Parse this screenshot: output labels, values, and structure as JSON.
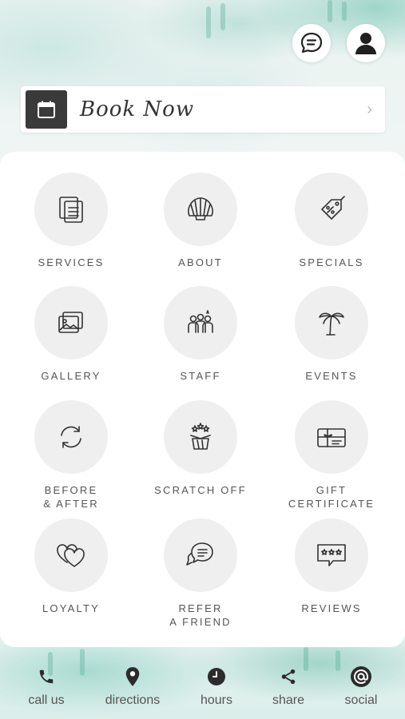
{
  "header": {
    "book_label": "Book Now"
  },
  "tiles": [
    {
      "label": "SERVICES",
      "icon": "documents-icon"
    },
    {
      "label": "ABOUT",
      "icon": "shell-icon"
    },
    {
      "label": "SPECIALS",
      "icon": "price-tag-icon"
    },
    {
      "label": "GALLERY",
      "icon": "photos-icon"
    },
    {
      "label": "STAFF",
      "icon": "people-icon"
    },
    {
      "label": "EVENTS",
      "icon": "palm-tree-icon"
    },
    {
      "label": "BEFORE\n& AFTER",
      "icon": "refresh-icon"
    },
    {
      "label": "SCRATCH OFF",
      "icon": "surprise-box-icon"
    },
    {
      "label": "GIFT\nCERTIFICATE",
      "icon": "gift-card-icon"
    },
    {
      "label": "LOYALTY",
      "icon": "hearts-icon"
    },
    {
      "label": "REFER\nA FRIEND",
      "icon": "chat-bubbles-icon"
    },
    {
      "label": "REVIEWS",
      "icon": "star-rating-icon"
    }
  ],
  "bottom_nav": [
    {
      "label": "call us",
      "icon": "phone-icon"
    },
    {
      "label": "directions",
      "icon": "map-pin-icon"
    },
    {
      "label": "hours",
      "icon": "clock-icon"
    },
    {
      "label": "share",
      "icon": "share-icon"
    },
    {
      "label": "social",
      "icon": "at-sign-icon"
    }
  ],
  "colors": {
    "accent_dark": "#3a3a3a",
    "tile_circle": "#efefef",
    "watercolor": "#62beaa"
  }
}
